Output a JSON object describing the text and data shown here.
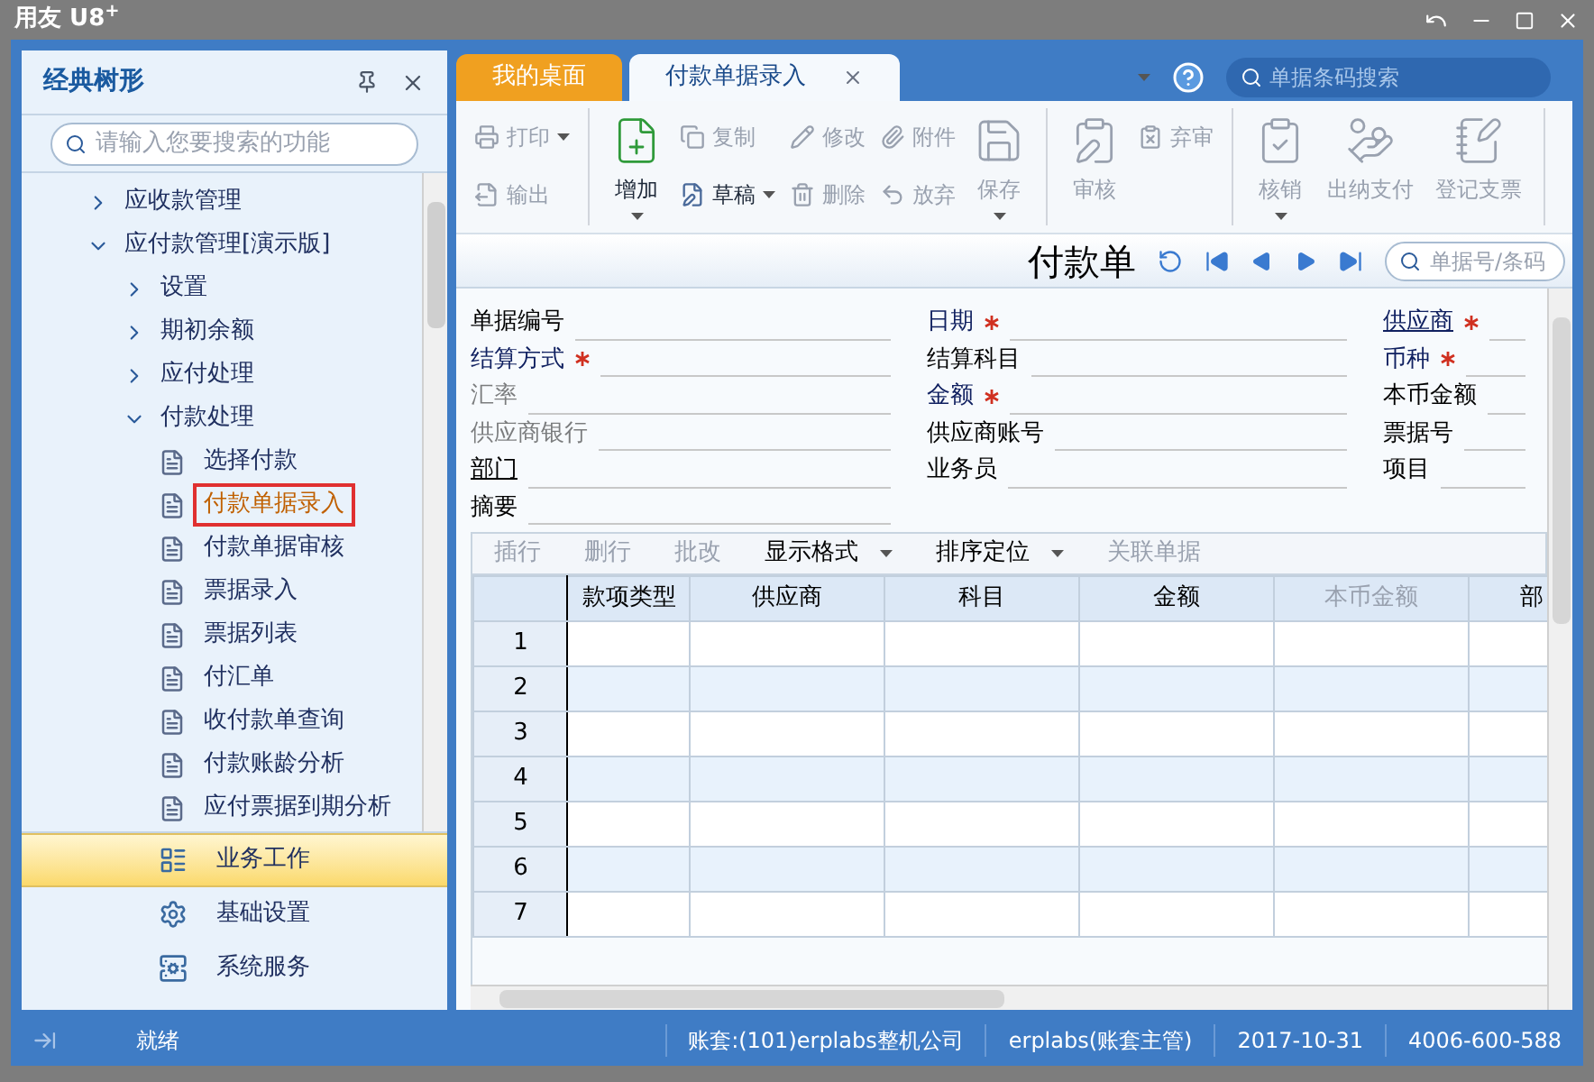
{
  "window": {
    "title": "用友 U8$^{+}$"
  },
  "tree_panel": {
    "title": "经典树形",
    "search": {
      "placeholder": "请输入您要搜索的功能"
    },
    "items": [
      {
        "label": "应收款管理",
        "expanded": false,
        "selected": false
      },
      {
        "label": "应付款管理[演示版]",
        "expanded": true,
        "selected": false,
        "children": [
          {
            "label": "设置",
            "expanded": false,
            "selected": false
          },
          {
            "label": "期初余额",
            "expanded": false,
            "selected": false
          },
          {
            "label": "应付处理",
            "expanded": false,
            "selected": false
          },
          {
            "label": "付款处理",
            "expanded": true,
            "selected": false,
            "children": [
              {
                "label": "选择付款",
                "kind": "leaf",
                "selected": false
              },
              {
                "label": "付款单据录入",
                "kind": "leaf",
                "selected": true
              },
              {
                "label": "付款单据审核",
                "kind": "leaf",
                "selected": false
              },
              {
                "label": "票据录入",
                "kind": "leaf",
                "selected": false
              },
              {
                "label": "票据列表",
                "kind": "leaf",
                "selected": false
              },
              {
                "label": "付汇单",
                "kind": "leaf",
                "selected": false
              },
              {
                "label": "收付款单查询",
                "kind": "leaf",
                "selected": false
              },
              {
                "label": "付款账龄分析",
                "kind": "leaf",
                "selected": false
              },
              {
                "label": "应付票据到期分析",
                "kind": "leaf",
                "selected": false
              }
            ]
          }
        ]
      }
    ]
  },
  "nav": [
    {
      "label": "业务工作",
      "selected": true
    },
    {
      "label": "基础设置",
      "selected": false
    },
    {
      "label": "系统服务",
      "selected": false
    }
  ],
  "tabs": [
    {
      "label": "我的桌面",
      "selected": false,
      "closable": false
    },
    {
      "label": "付款单据录入",
      "selected": true,
      "closable": true
    }
  ],
  "global_search": {
    "placeholder": "单据条码搜索"
  },
  "toolbar": [
    [
      {
        "label": "打印",
        "kind": "small",
        "disabled": true,
        "dropdown": true
      },
      {
        "label": "输出",
        "kind": "small",
        "disabled": true,
        "dropdown": false
      }
    ],
    [
      {
        "label": "增加",
        "kind": "large",
        "disabled": false,
        "dropdown": true
      },
      {
        "label": "复制",
        "kind": "small",
        "disabled": true,
        "dropdown": false
      },
      {
        "label": "草稿",
        "kind": "small",
        "disabled": false,
        "dropdown": true
      },
      {
        "label": "修改",
        "kind": "small",
        "disabled": true,
        "dropdown": false
      },
      {
        "label": "删除",
        "kind": "small",
        "disabled": true,
        "dropdown": false
      },
      {
        "label": "附件",
        "kind": "small",
        "disabled": true,
        "dropdown": false
      },
      {
        "label": "放弃",
        "kind": "small",
        "disabled": true,
        "dropdown": false
      },
      {
        "label": "保存",
        "kind": "large",
        "disabled": true,
        "dropdown": true
      }
    ],
    [
      {
        "label": "审核",
        "kind": "large",
        "disabled": true,
        "dropdown": false
      },
      {
        "label": "弃审",
        "kind": "small",
        "disabled": true,
        "dropdown": false
      }
    ],
    [
      {
        "label": "核销",
        "kind": "large",
        "disabled": true,
        "dropdown": true
      },
      {
        "label": "出纳支付",
        "kind": "large",
        "disabled": true,
        "dropdown": false
      },
      {
        "label": "登记支票",
        "kind": "large",
        "disabled": true,
        "dropdown": false
      }
    ]
  ],
  "form": {
    "title": "付款单",
    "search": {
      "placeholder": "单据号/条码"
    },
    "columns": [
      [
        {
          "label": "单据编号",
          "emphasized": false,
          "disabled": false,
          "required": false,
          "underlined": false
        },
        {
          "label": "结算方式",
          "emphasized": true,
          "disabled": false,
          "required": true,
          "underlined": false
        },
        {
          "label": "汇率",
          "emphasized": false,
          "disabled": true,
          "required": false,
          "underlined": false
        },
        {
          "label": "供应商银行",
          "emphasized": false,
          "disabled": true,
          "required": false,
          "underlined": false
        },
        {
          "label": "部门",
          "emphasized": false,
          "disabled": false,
          "required": false,
          "underlined": true
        },
        {
          "label": "摘要",
          "emphasized": false,
          "disabled": false,
          "required": false,
          "underlined": false
        }
      ],
      [
        {
          "label": "日期",
          "emphasized": true,
          "disabled": false,
          "required": true,
          "underlined": false
        },
        {
          "label": "结算科目",
          "emphasized": false,
          "disabled": false,
          "required": false,
          "underlined": false
        },
        {
          "label": "金额",
          "emphasized": true,
          "disabled": false,
          "required": true,
          "underlined": false
        },
        {
          "label": "供应商账号",
          "emphasized": false,
          "disabled": false,
          "required": false,
          "underlined": false
        },
        {
          "label": "业务员",
          "emphasized": false,
          "disabled": false,
          "required": false,
          "underlined": false
        }
      ],
      [
        {
          "label": "供应商",
          "emphasized": true,
          "disabled": false,
          "required": true,
          "underlined": true
        },
        {
          "label": "币种",
          "emphasized": true,
          "disabled": false,
          "required": true,
          "underlined": false
        },
        {
          "label": "本币金额",
          "emphasized": false,
          "disabled": false,
          "required": false,
          "underlined": false
        },
        {
          "label": "票据号",
          "emphasized": false,
          "disabled": false,
          "required": false,
          "underlined": false
        },
        {
          "label": "项目",
          "emphasized": false,
          "disabled": false,
          "required": false,
          "underlined": false
        }
      ]
    ]
  },
  "grid_toolbar": [
    {
      "label": "插行",
      "disabled": true,
      "dropdown": false
    },
    {
      "label": "删行",
      "disabled": true,
      "dropdown": false
    },
    {
      "label": "批改",
      "disabled": true,
      "dropdown": false
    },
    {
      "label": "显示格式",
      "disabled": false,
      "dropdown": true
    },
    {
      "label": "排序定位",
      "disabled": false,
      "dropdown": true
    },
    {
      "label": "关联单据",
      "disabled": true,
      "dropdown": false
    }
  ],
  "table": {
    "columns": [
      {
        "label": "款项类型",
        "disabled": false
      },
      {
        "label": "供应商",
        "disabled": false
      },
      {
        "label": "科目",
        "disabled": false
      },
      {
        "label": "金额",
        "disabled": false
      },
      {
        "label": "本币金额",
        "disabled": true
      },
      {
        "label": "部",
        "disabled": false
      }
    ],
    "rows": [
      "1",
      "2",
      "3",
      "4",
      "5",
      "6",
      "7"
    ]
  },
  "status_bar": {
    "status": "就绪",
    "account_set": "账套:(101)erplabs整机公司",
    "user": "erplabs(账套主管)",
    "date": "2017-10-31",
    "phone": "4006-600-588"
  }
}
